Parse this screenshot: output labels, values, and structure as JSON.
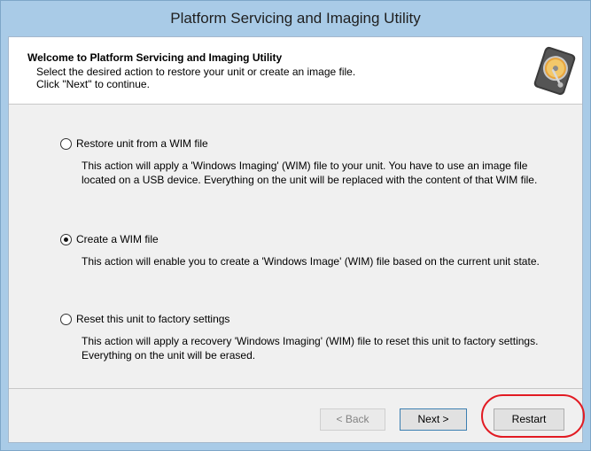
{
  "window": {
    "title": "Platform Servicing and Imaging Utility"
  },
  "header": {
    "title": "Welcome to Platform Servicing and Imaging Utility",
    "line1": "Select the desired action to restore your unit or create an image file.",
    "line2": "Click \"Next\" to continue.",
    "icon": "hard-drive-icon"
  },
  "options": [
    {
      "label": "Restore unit from a WIM file",
      "description": "This action will apply a 'Windows Imaging' (WIM) file to your unit. You have to use an image file located on a USB device. Everything on the unit will be replaced with the content of that WIM file.",
      "selected": false
    },
    {
      "label": "Create a WIM file",
      "description": "This action will enable you to create a 'Windows Image' (WIM) file based on the current unit state.",
      "selected": true
    },
    {
      "label": "Reset this unit to factory settings",
      "description": "This action will apply a recovery 'Windows Imaging' (WIM) file to reset this unit to factory settings. Everything on the unit will be erased.",
      "selected": false
    }
  ],
  "buttons": {
    "back": "< Back",
    "next": "Next >",
    "restart": "Restart"
  },
  "colors": {
    "frame": "#a9cbe7",
    "highlight": "#e21b23"
  }
}
